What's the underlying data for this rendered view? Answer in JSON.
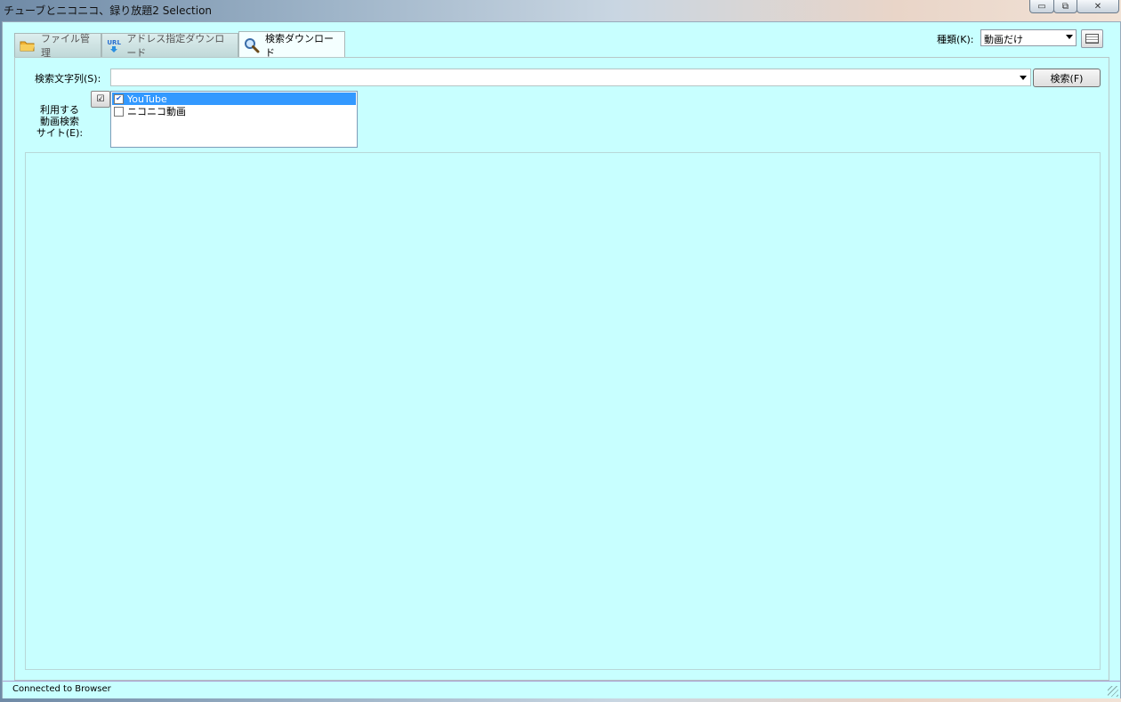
{
  "window": {
    "title": "チューブとニコニコ、録り放題2 Selection",
    "caption_buttons": {
      "minimize": "▭",
      "maximize": "⧉",
      "close": "✕"
    }
  },
  "tabs": [
    {
      "label": "ファイル管理",
      "icon": "folder-icon"
    },
    {
      "label": "アドレス指定ダウンロード",
      "icon": "url-download-icon",
      "icon_text": "URL"
    },
    {
      "label": "検索ダウンロード",
      "icon": "magnifier-icon",
      "active": true
    }
  ],
  "kind": {
    "label": "種類(K):",
    "value": "動画だけ"
  },
  "search": {
    "label": "検索文字列(S):",
    "value": "",
    "button": "検索(F)"
  },
  "sites": {
    "label_lines": [
      "利用する",
      "動画検索",
      "サイト(E):"
    ],
    "toggle_glyph": "☑",
    "items": [
      {
        "label": "YouTube",
        "checked": true,
        "selected": true
      },
      {
        "label": "ニコニコ動画",
        "checked": false,
        "selected": false
      }
    ]
  },
  "status": {
    "text": "Connected to Browser"
  },
  "colors": {
    "background": "#c8ffff",
    "selection": "#3399ff"
  }
}
